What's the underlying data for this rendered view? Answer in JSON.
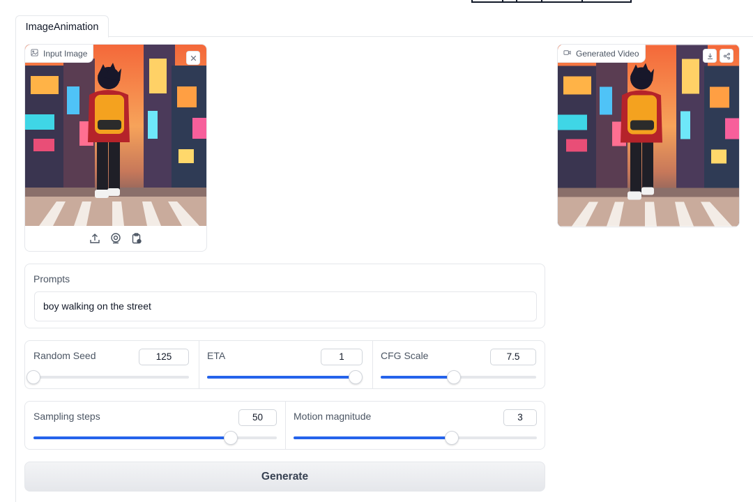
{
  "tabs": [
    {
      "label": "ImageAnimation",
      "active": true
    }
  ],
  "input_image": {
    "label": "Input Image",
    "icons": [
      "image-icon",
      "close-icon",
      "upload-icon",
      "webcam-icon",
      "clipboard-icon"
    ]
  },
  "generated_video": {
    "label": "Generated Video",
    "icons": [
      "video-icon",
      "download-icon",
      "share-icon"
    ]
  },
  "prompts": {
    "label": "Prompts",
    "value": "boy walking on the street"
  },
  "sliders_row1": [
    {
      "label": "Random Seed",
      "value": "125",
      "level": 0.0
    },
    {
      "label": "ETA",
      "value": "1",
      "level": 1.0
    },
    {
      "label": "CFG Scale",
      "value": "7.5",
      "level": 0.47
    }
  ],
  "sliders_row2": [
    {
      "label": "Sampling steps",
      "value": "50",
      "level": 0.81
    },
    {
      "label": "Motion magnitude",
      "value": "3",
      "level": 0.65
    }
  ],
  "generate_label": "Generate",
  "colors": {
    "accent": "#2563eb",
    "border": "#e5e7eb"
  }
}
